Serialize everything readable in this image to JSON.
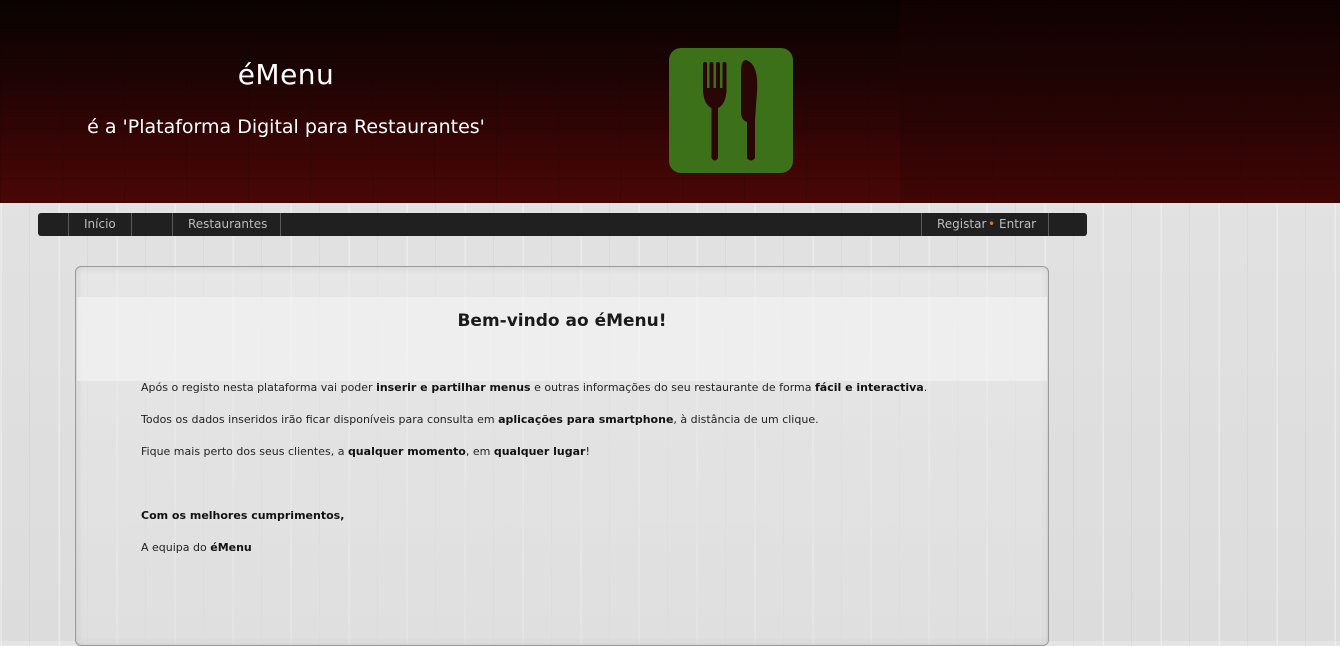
{
  "header": {
    "title": "éMenu",
    "tagline": "é a 'Plataforma Digital para Restaurantes'",
    "logo_icon": "fork-knife-icon",
    "logo_color": "#3c7119"
  },
  "nav": {
    "inicio": "Início",
    "restaurantes": "Restaurantes",
    "registar": "Registar",
    "separator": "•",
    "entrar": "Entrar"
  },
  "main": {
    "title": "Bem-vindo ao éMenu!",
    "p1": {
      "a": "Após o registo nesta plataforma vai poder ",
      "b": "inserir e partilhar menus",
      "c": " e outras informações do seu restaurante de forma ",
      "d": "fácil e interactiva",
      "e": "."
    },
    "p2": {
      "a": "Todos os dados inseridos irão ficar disponíveis para consulta em ",
      "b": "aplicações para smartphone",
      "c": ", à distância de um clique."
    },
    "p3": {
      "a": "Fique mais perto dos seus clientes, a ",
      "b": "qualquer momento",
      "c": ", em ",
      "d": "qualquer lugar",
      "e": "!"
    },
    "closing": "Com os melhores cumprimentos,",
    "signature": {
      "a": "A equipa do ",
      "b": "éMenu"
    }
  }
}
